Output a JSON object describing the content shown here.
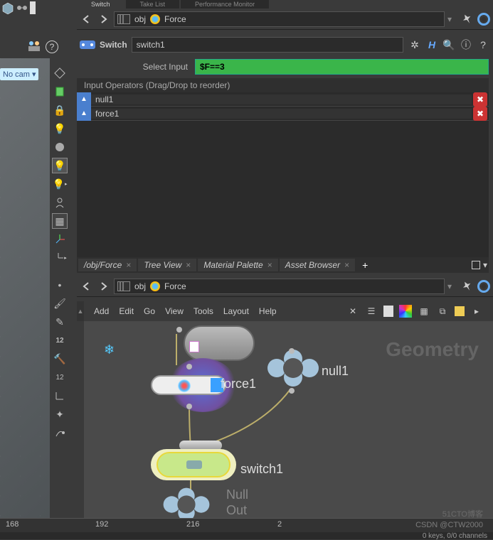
{
  "topTabs": [
    "Switch",
    "Take List",
    "Performance Monitor"
  ],
  "path": {
    "level": "obj",
    "node": "Force"
  },
  "node": {
    "type": "Switch",
    "name": "switch1"
  },
  "selectInput": {
    "label": "Select Input",
    "expr": "$F==3"
  },
  "opsHeader": "Input Operators (Drag/Drop to reorder)",
  "ops": [
    "null1",
    "force1"
  ],
  "viewport": {
    "camLabel": "No cam ▾"
  },
  "networkTabs": [
    "/obj/Force",
    "Tree View",
    "Material Palette",
    "Asset Browser"
  ],
  "menus": [
    "Add",
    "Edit",
    "Go",
    "View",
    "Tools",
    "Layout",
    "Help"
  ],
  "network": {
    "bigLabel": "Geometry",
    "force": "force1",
    "null": "null1",
    "switch": "switch1",
    "outType": "Null",
    "outName": "Out"
  },
  "timeline": {
    "t1": "168",
    "t2": "192",
    "t3": "216",
    "t4": "2"
  },
  "status": "0 keys, 0/0 channels",
  "watermark": "CSDN @CTW2000",
  "watermark2": "51CTO博客"
}
